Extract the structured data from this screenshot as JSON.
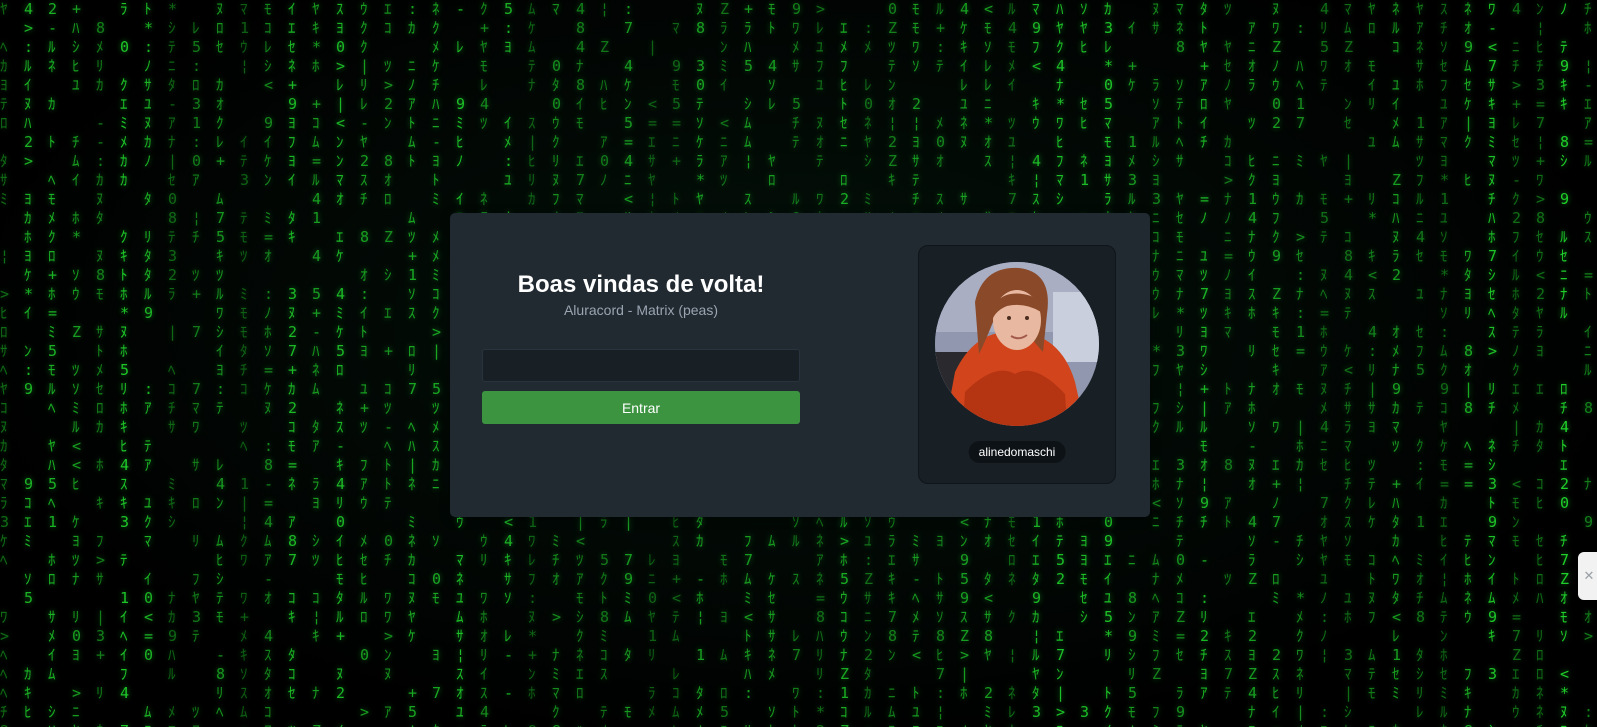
{
  "login": {
    "title": "Boas vindas de volta!",
    "subtitle": "Aluracord - Matrix (peas)",
    "username_value": "",
    "submit_label": "Entrar"
  },
  "profile": {
    "username": "alinedomaschi"
  },
  "colors": {
    "background": "#000000",
    "matrix_glyphs": "#1fcf2a",
    "panel": "#212931",
    "panel_inner": "#181f25",
    "button": "#3c9340",
    "text_primary": "#ffffff",
    "text_secondary": "#9aa5b1"
  },
  "icons": {
    "side_widget": "puzzle-icon"
  }
}
